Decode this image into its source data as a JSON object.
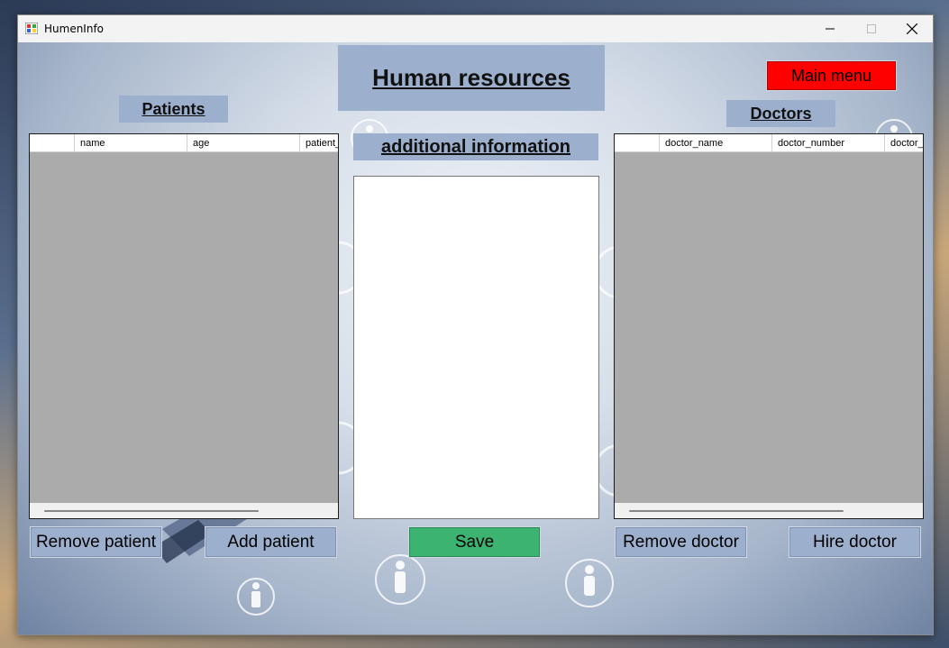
{
  "window": {
    "title": "HumenInfo",
    "icons": {
      "app": "app-icon",
      "minimize": "minimize-icon",
      "maximize": "maximize-icon",
      "close": "close-icon"
    }
  },
  "header": {
    "title": "Human resources"
  },
  "main_menu": {
    "label": "Main menu",
    "color": "#ff0000"
  },
  "patients": {
    "label": "Patients",
    "columns": [
      "",
      "name",
      "age",
      "patient_"
    ],
    "remove_label": "Remove patient",
    "add_label": "Add patient"
  },
  "info": {
    "label": "additional information",
    "text": "",
    "save_label": "Save",
    "save_color": "#3cb371"
  },
  "doctors": {
    "label": "Doctors",
    "columns": [
      "",
      "doctor_name",
      "doctor_number",
      "doctor_"
    ],
    "remove_label": "Remove doctor",
    "hire_label": "Hire doctor"
  },
  "colors": {
    "accent": "#9cb0cd",
    "grid_bg": "#ababab"
  }
}
